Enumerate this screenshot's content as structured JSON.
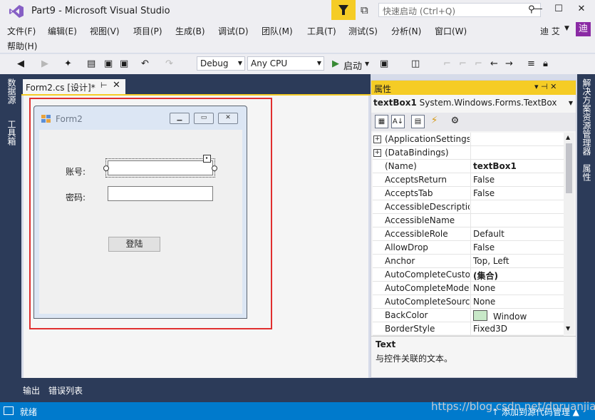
{
  "window": {
    "title": "Part9 - Microsoft Visual Studio",
    "quick_launch_placeholder": "快速启动 (Ctrl+Q)",
    "minimize": "—",
    "maximize": "☐",
    "close": "✕"
  },
  "menu": [
    "文件(F)",
    "编辑(E)",
    "视图(V)",
    "项目(P)",
    "生成(B)",
    "调试(D)",
    "团队(M)",
    "工具(T)",
    "测试(S)",
    "分析(N)",
    "窗口(W)",
    "帮助(H)"
  ],
  "user": {
    "name": "迪 艾",
    "avatar": "迪"
  },
  "toolbar": {
    "config": "Debug",
    "platform": "Any CPU",
    "start": "启动"
  },
  "left_rail": [
    "数据源",
    "工具箱"
  ],
  "right_rail": [
    "解决方案资源管理器",
    "属性"
  ],
  "document": {
    "tab": "Form2.cs [设计]*",
    "pin": "⊢",
    "close": "✕"
  },
  "form": {
    "title": "Form2",
    "label_account": "账号:",
    "label_password": "密码:",
    "login_button": "登陆"
  },
  "properties": {
    "title": "属性",
    "object_name": "textBox1",
    "object_type": "System.Windows.Forms.TextBox",
    "rows": [
      {
        "name": "(ApplicationSettings)",
        "value": "",
        "expandable": true
      },
      {
        "name": "(DataBindings)",
        "value": "",
        "expandable": true
      },
      {
        "name": "(Name)",
        "value": "textBox1",
        "bold": true
      },
      {
        "name": "AcceptsReturn",
        "value": "False"
      },
      {
        "name": "AcceptsTab",
        "value": "False"
      },
      {
        "name": "AccessibleDescriptio",
        "value": ""
      },
      {
        "name": "AccessibleName",
        "value": ""
      },
      {
        "name": "AccessibleRole",
        "value": "Default"
      },
      {
        "name": "AllowDrop",
        "value": "False"
      },
      {
        "name": "Anchor",
        "value": "Top, Left"
      },
      {
        "name": "AutoCompleteCustor",
        "value": "(集合)",
        "bold": true
      },
      {
        "name": "AutoCompleteMode",
        "value": "None"
      },
      {
        "name": "AutoCompleteSource",
        "value": "None"
      },
      {
        "name": "BackColor",
        "value": "Window",
        "swatch": "#c8e8c8"
      },
      {
        "name": "BorderStyle",
        "value": "Fixed3D"
      }
    ],
    "desc_title": "Text",
    "desc_text": "与控件关联的文本。"
  },
  "bottom_tabs": [
    "输出",
    "错误列表"
  ],
  "status": {
    "text": "就绪",
    "source_control": "↑ 添加到源代码管理 ▲"
  },
  "watermark": "https://blog.csdn.net/dnruanjian",
  "colors": {
    "accent": "#007acc",
    "highlight": "#f5cc25",
    "selection_frame": "#e02f2f",
    "rail": "#2c3b59"
  }
}
